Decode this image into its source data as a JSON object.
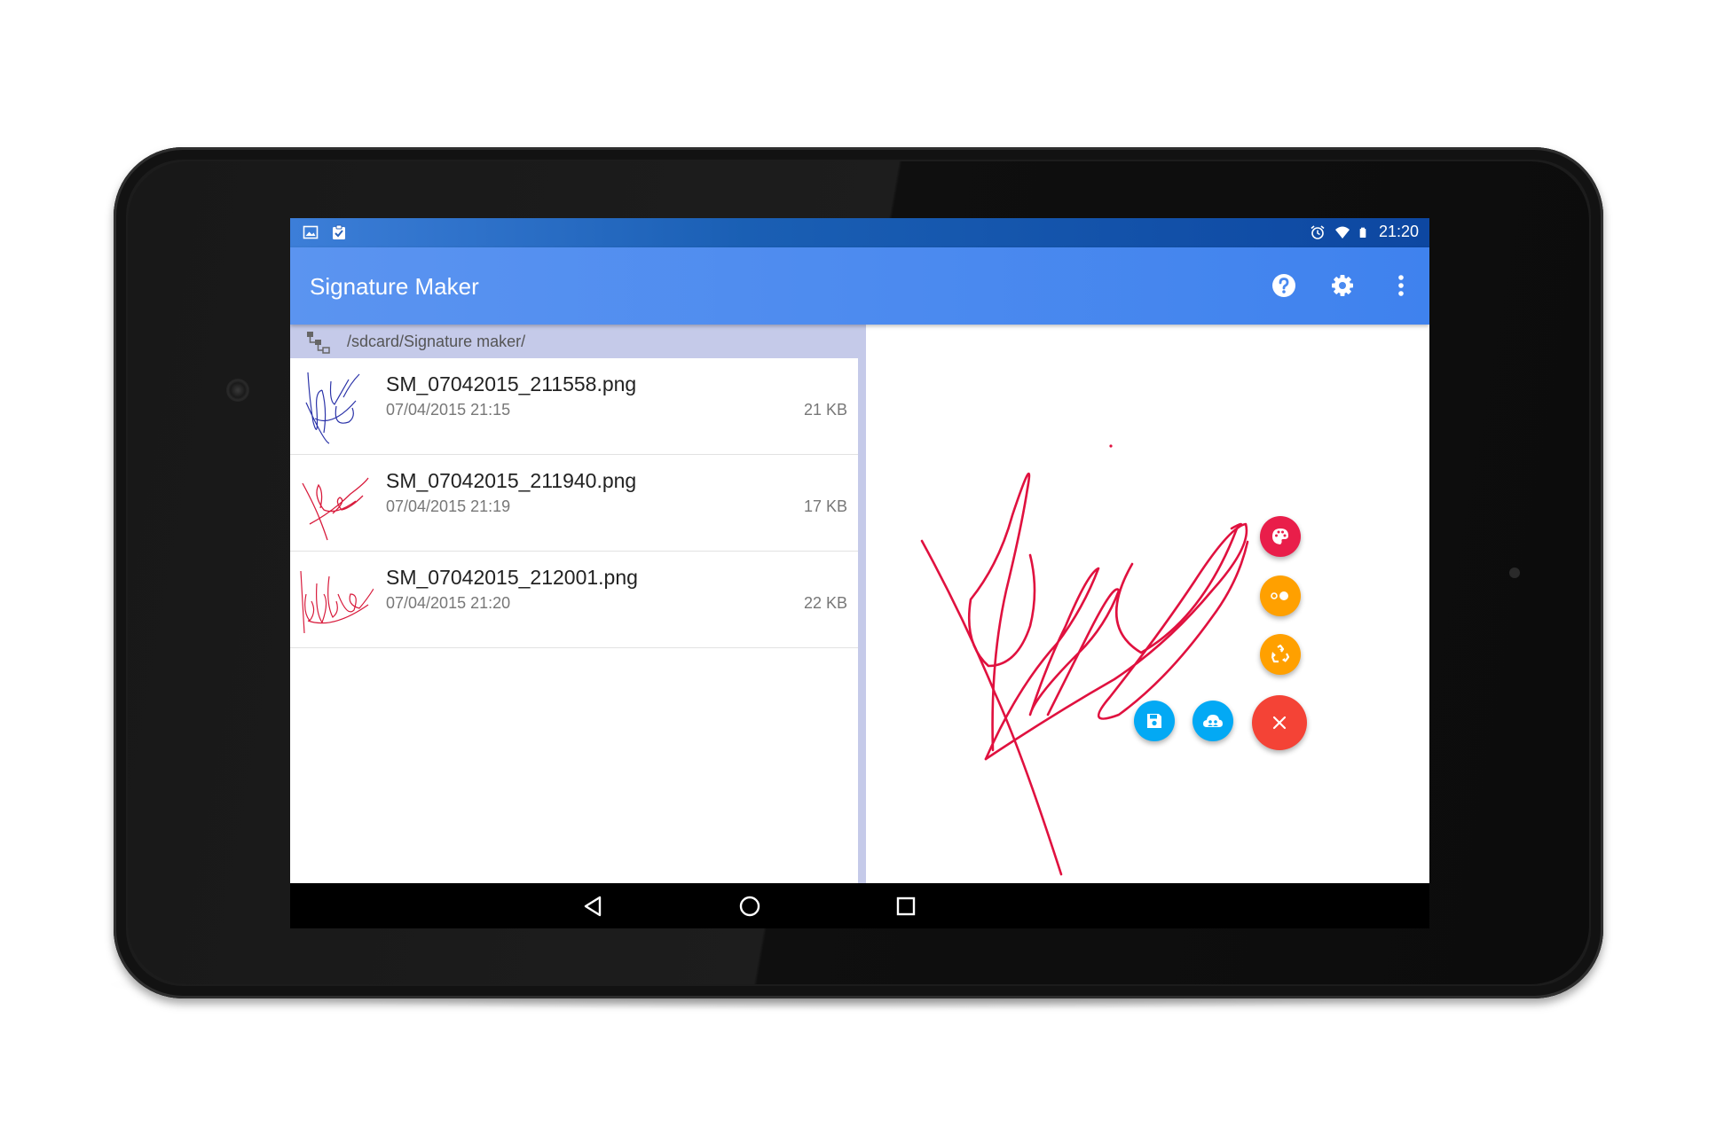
{
  "status_bar": {
    "left_icons": [
      "image-icon",
      "clipboard-check-icon"
    ],
    "right_icons": [
      "alarm-icon",
      "wifi-icon",
      "battery-icon"
    ],
    "time": "21:20"
  },
  "app_bar": {
    "title": "Signature Maker",
    "actions": [
      "help-icon",
      "settings-gear-icon",
      "overflow-menu-icon"
    ]
  },
  "path": "/sdcard/Signature maker/",
  "files": [
    {
      "name": "SM_07042015_211558.png",
      "date": "07/04/2015 21:15",
      "size": "21 KB",
      "thumb_color": "#2a32a8"
    },
    {
      "name": "SM_07042015_211940.png",
      "date": "07/04/2015 21:19",
      "size": "17 KB",
      "thumb_color": "#d81b3c"
    },
    {
      "name": "SM_07042015_212001.png",
      "date": "07/04/2015 21:20",
      "size": "22 KB",
      "thumb_color": "#d81b3c"
    }
  ],
  "canvas": {
    "stroke_color": "#e0113f"
  },
  "fab_actions": [
    {
      "name": "palette-icon",
      "color": "#e91e4a"
    },
    {
      "name": "brush-size-icon",
      "color": "#ffa000"
    },
    {
      "name": "recycle-icon",
      "color": "#ffa000"
    },
    {
      "name": "save-icon",
      "color": "#03a9f4"
    },
    {
      "name": "cloud-share-icon",
      "color": "#03a9f4"
    },
    {
      "name": "close-icon",
      "color": "#f44336"
    }
  ],
  "nav_bar": [
    "back-icon",
    "home-icon",
    "recents-icon"
  ],
  "colors": {
    "status_bar": "#1a5fb4",
    "app_bar": "#4a8af0",
    "path_bar": "#c5cae9"
  }
}
